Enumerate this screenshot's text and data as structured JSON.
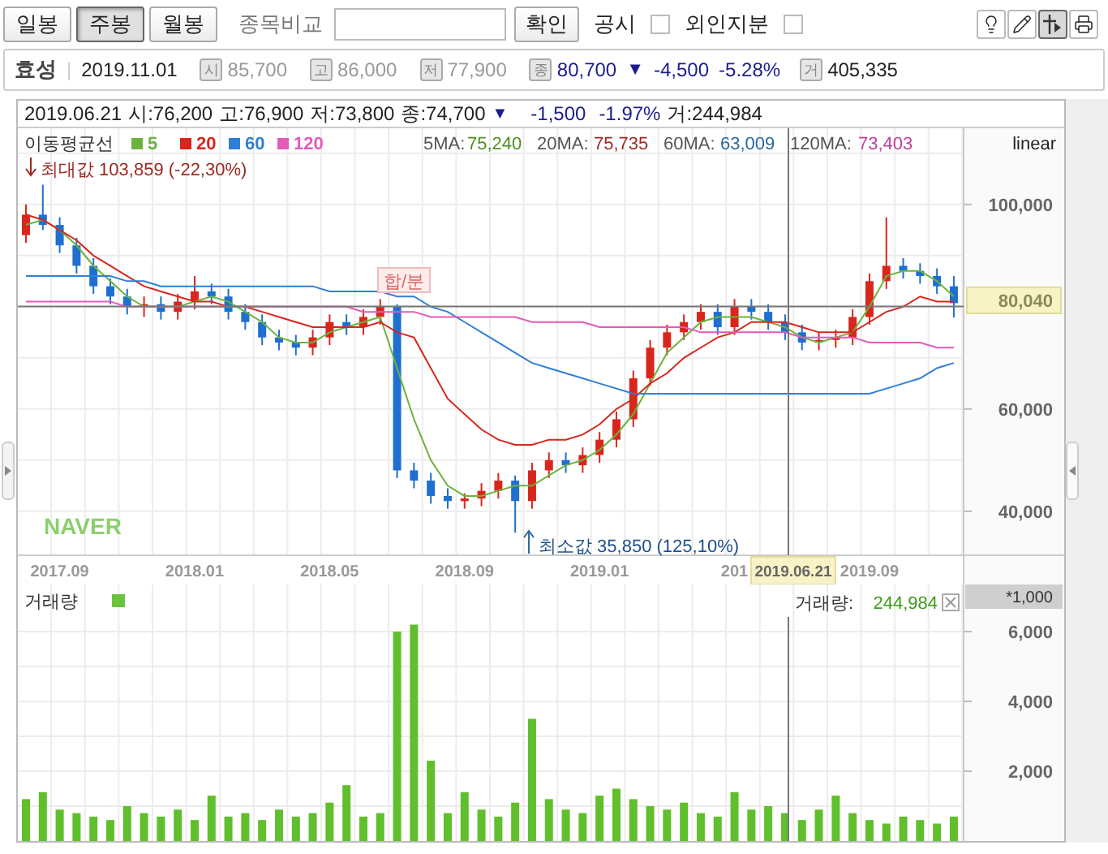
{
  "toolbar": {
    "period_tabs": [
      {
        "label": "일봉",
        "selected": false
      },
      {
        "label": "주봉",
        "selected": true
      },
      {
        "label": "월봉",
        "selected": false
      }
    ],
    "compare_label": "종목비교",
    "confirm_button": "확인",
    "toggles": [
      {
        "label": "공시",
        "checked": false
      },
      {
        "label": "외인지분",
        "checked": false
      }
    ],
    "tools": [
      {
        "kind": "bulb",
        "selected": false
      },
      {
        "kind": "pencil",
        "selected": false
      },
      {
        "kind": "crosshair",
        "selected": true
      },
      {
        "kind": "print",
        "selected": false
      }
    ]
  },
  "info_bar": {
    "name": "효성",
    "separator": "|",
    "date": "2019.11.01",
    "quotes": [
      {
        "badge": "시",
        "value": "85,700",
        "kind": "plain"
      },
      {
        "badge": "고",
        "value": "86,000",
        "kind": "plain"
      },
      {
        "badge": "저",
        "value": "77,900",
        "kind": "plain"
      },
      {
        "badge": "종",
        "value": "80,700",
        "kind": "close"
      }
    ],
    "change_arrow": "▼",
    "change": "-4,500",
    "change_pct": "-5.28%",
    "volume_badge": "거",
    "volume": "405,335"
  },
  "chart_header": {
    "date": "2019.06.21",
    "fields": [
      "시:76,200",
      "고:76,900",
      "저:73,800",
      "종:74,700"
    ],
    "arrow": "▼",
    "change": "-1,500",
    "change_pct": "-1.97%",
    "volume": "거:244,984"
  },
  "price_panel": {
    "legend_title": "이동평균선",
    "ma_readings": [
      {
        "label": "5MA:",
        "value": "75,240",
        "color": "#4e8f1f"
      },
      {
        "label": "20MA:",
        "value": "75,735",
        "color": "#9b2a22"
      },
      {
        "label": "60MA:",
        "value": "63,009",
        "color": "#2a6aa0"
      },
      {
        "label": "120MA:",
        "value": "73,403",
        "color": "#c23f9a"
      }
    ],
    "scale_label": "linear",
    "max_annotation": "최대값 103,859 (-22,30%)",
    "min_annotation": "최소값 35,850 (125,10%)",
    "split_marker": "합/분",
    "logo": "NAVER",
    "crosshair": {
      "price_label": "80,040",
      "date_label": "2019.06.21"
    },
    "chart_data": {
      "type": "candlestick",
      "grid": true,
      "legend": "top-left",
      "categories": [
        null,
        null,
        "2017.09",
        null,
        null,
        null,
        null,
        null,
        null,
        null,
        "2018.01",
        null,
        null,
        null,
        null,
        null,
        null,
        null,
        "2018.05",
        null,
        null,
        null,
        null,
        null,
        null,
        null,
        "2018.09",
        null,
        null,
        null,
        null,
        null,
        null,
        null,
        "2019.01",
        null,
        null,
        null,
        null,
        null,
        null,
        null,
        "201",
        null,
        null,
        null,
        null,
        null,
        null,
        null,
        "2019.09",
        null,
        null,
        null,
        null,
        null
      ],
      "ohlc": [
        [
          94000,
          100000,
          92500,
          98000
        ],
        [
          98000,
          103859,
          95000,
          96000
        ],
        [
          96000,
          97500,
          90500,
          92000
        ],
        [
          92000,
          93500,
          86500,
          88000
        ],
        [
          88000,
          89500,
          82500,
          84000
        ],
        [
          84000,
          85500,
          80500,
          82000
        ],
        [
          82000,
          83500,
          78500,
          80000
        ],
        [
          80000,
          82000,
          78000,
          80500
        ],
        [
          80500,
          82000,
          77500,
          79000
        ],
        [
          79000,
          82500,
          77500,
          81000
        ],
        [
          81000,
          86000,
          79500,
          83000
        ],
        [
          83000,
          84500,
          80500,
          82000
        ],
        [
          82000,
          83500,
          77500,
          79000
        ],
        [
          79000,
          80500,
          75500,
          77000
        ],
        [
          77000,
          78500,
          72500,
          74000
        ],
        [
          74000,
          75500,
          71500,
          73000
        ],
        [
          73000,
          74500,
          70500,
          72000
        ],
        [
          72000,
          75500,
          70500,
          74000
        ],
        [
          74000,
          78500,
          72500,
          77000
        ],
        [
          77000,
          78500,
          74500,
          76000
        ],
        [
          76000,
          79500,
          74500,
          78000
        ],
        [
          78000,
          81500,
          76500,
          80000
        ],
        [
          80000,
          80500,
          46500,
          48000
        ],
        [
          48000,
          49500,
          44500,
          46000
        ],
        [
          46000,
          47500,
          41500,
          43000
        ],
        [
          43000,
          44500,
          40500,
          42000
        ],
        [
          42000,
          43500,
          40500,
          42500
        ],
        [
          42500,
          45500,
          41000,
          44000
        ],
        [
          44000,
          47500,
          42500,
          46000
        ],
        [
          46000,
          47000,
          35850,
          42000
        ],
        [
          42000,
          49500,
          40500,
          48000
        ],
        [
          48000,
          51500,
          46500,
          50000
        ],
        [
          50000,
          51500,
          47500,
          49000
        ],
        [
          49000,
          52500,
          47500,
          51000
        ],
        [
          51000,
          55500,
          49500,
          54000
        ],
        [
          54000,
          59500,
          52500,
          58000
        ],
        [
          58000,
          67500,
          56500,
          66000
        ],
        [
          66000,
          73500,
          64500,
          72000
        ],
        [
          72000,
          76500,
          70500,
          75000
        ],
        [
          75000,
          78500,
          73500,
          77000
        ],
        [
          77000,
          80500,
          75500,
          79000
        ],
        [
          79000,
          80500,
          74500,
          76000
        ],
        [
          76000,
          81500,
          74500,
          80000
        ],
        [
          80000,
          81500,
          77500,
          79000
        ],
        [
          79000,
          80500,
          75500,
          77000
        ],
        [
          77000,
          78500,
          73500,
          75000
        ],
        [
          75000,
          76500,
          71500,
          73000
        ],
        [
          73000,
          75000,
          71500,
          73500
        ],
        [
          73500,
          75500,
          72000,
          74000
        ],
        [
          74000,
          79500,
          72500,
          78000
        ],
        [
          78000,
          86500,
          76500,
          85000
        ],
        [
          85000,
          97500,
          83500,
          88000
        ],
        [
          88000,
          89500,
          85500,
          87000
        ],
        [
          87000,
          88500,
          84500,
          86000
        ],
        [
          86000,
          87500,
          82500,
          84000
        ],
        [
          84000,
          86000,
          77900,
          80700
        ]
      ],
      "series": [
        {
          "name": "5",
          "type": "line",
          "color": "#6bb33c",
          "values": [
            96000,
            97000,
            95000,
            92000,
            88000,
            85000,
            82000,
            80000,
            80000,
            80000,
            81000,
            82000,
            81000,
            79000,
            77000,
            74000,
            73000,
            73000,
            75000,
            76000,
            77000,
            78000,
            68000,
            58000,
            50000,
            45000,
            43000,
            43000,
            44000,
            45000,
            45000,
            47000,
            49000,
            50000,
            52000,
            55000,
            59000,
            65000,
            71000,
            74000,
            77000,
            78000,
            78000,
            78000,
            77000,
            76000,
            74000,
            73000,
            74000,
            75000,
            80000,
            86000,
            87000,
            87000,
            85000,
            82000
          ]
        },
        {
          "name": "20",
          "type": "line",
          "color": "#d9261c",
          "values": [
            98000,
            97000,
            95000,
            93000,
            90000,
            88000,
            86000,
            84000,
            83000,
            82000,
            81000,
            81000,
            80000,
            80000,
            79000,
            78000,
            77000,
            76000,
            76000,
            76000,
            76000,
            77000,
            75000,
            74000,
            68000,
            62000,
            59000,
            56000,
            54000,
            53000,
            53000,
            54000,
            54000,
            55000,
            57000,
            60000,
            62000,
            65000,
            67000,
            70000,
            72000,
            74000,
            75000,
            77000,
            77000,
            77000,
            76000,
            75000,
            75000,
            75000,
            77000,
            79000,
            80000,
            82000,
            81000,
            81000
          ]
        },
        {
          "name": "60",
          "type": "line",
          "color": "#2f7fd6",
          "values": [
            86000,
            86000,
            86000,
            86000,
            86000,
            86000,
            85000,
            85000,
            84000,
            84000,
            84000,
            84000,
            84000,
            84000,
            84000,
            84000,
            84000,
            84000,
            83000,
            83000,
            83000,
            83000,
            82000,
            82000,
            80000,
            79000,
            77000,
            75000,
            73000,
            71000,
            69000,
            68000,
            67000,
            66000,
            65000,
            64000,
            63000,
            63000,
            63000,
            63000,
            63000,
            63000,
            63000,
            63000,
            63000,
            63000,
            63000,
            63000,
            63000,
            63000,
            63000,
            64000,
            65000,
            66000,
            68000,
            69000
          ]
        },
        {
          "name": "120",
          "type": "line",
          "color": "#e45ab8",
          "values": [
            81000,
            81000,
            81000,
            81000,
            81000,
            81000,
            80000,
            80000,
            80000,
            80000,
            80000,
            80000,
            80000,
            80000,
            80000,
            80000,
            80000,
            80000,
            80000,
            80000,
            79000,
            79000,
            79000,
            79000,
            78000,
            78000,
            78000,
            78000,
            78000,
            78000,
            77000,
            77000,
            77000,
            77000,
            76000,
            76000,
            76000,
            76000,
            76000,
            76000,
            75000,
            75000,
            75000,
            75000,
            75000,
            75000,
            74000,
            74000,
            74000,
            74000,
            73000,
            73000,
            73000,
            73000,
            72000,
            72000
          ]
        }
      ],
      "ref_lines": [
        {
          "axis": "y",
          "value": 80040
        }
      ],
      "ylim": [
        31400,
        114900
      ],
      "yticks": [
        {
          "value": 100000,
          "label": "100,000"
        },
        {
          "value": 60000,
          "label": "60,000"
        },
        {
          "value": 40000,
          "label": "40,000"
        }
      ]
    }
  },
  "volume_panel": {
    "title": "거래량",
    "reading_label": "거래량:",
    "reading": "244,984",
    "unit_label": "*1,000",
    "chart_data": {
      "type": "bar",
      "grid": true,
      "categories": [
        null,
        null,
        null,
        null,
        null,
        null,
        null,
        null,
        null,
        null,
        null,
        null,
        null,
        null,
        null,
        null,
        null,
        null,
        null,
        null,
        null,
        null,
        null,
        null,
        null,
        null,
        null,
        null,
        null,
        null,
        null,
        null,
        null,
        null,
        null,
        null,
        null,
        null,
        null,
        null,
        null,
        null,
        null,
        null,
        null,
        null,
        null,
        null,
        null,
        null,
        null,
        null,
        null,
        null,
        null,
        null
      ],
      "values": [
        1200,
        1400,
        900,
        800,
        700,
        600,
        1000,
        800,
        700,
        900,
        600,
        1300,
        700,
        800,
        600,
        900,
        700,
        800,
        1100,
        1600,
        700,
        800,
        6000,
        6200,
        2300,
        800,
        1400,
        900,
        700,
        1100,
        3500,
        1200,
        900,
        800,
        1300,
        1500,
        1200,
        1000,
        900,
        1100,
        800,
        700,
        1400,
        900,
        1000,
        800,
        600,
        900,
        1300,
        800,
        600,
        500,
        700,
        600,
        500,
        700
      ],
      "ylim": [
        0,
        7350
      ],
      "yticks": [
        {
          "value": 2000,
          "label": "2,000"
        },
        {
          "value": 4000,
          "label": "4,000"
        },
        {
          "value": 6000,
          "label": "6,000"
        }
      ]
    }
  }
}
